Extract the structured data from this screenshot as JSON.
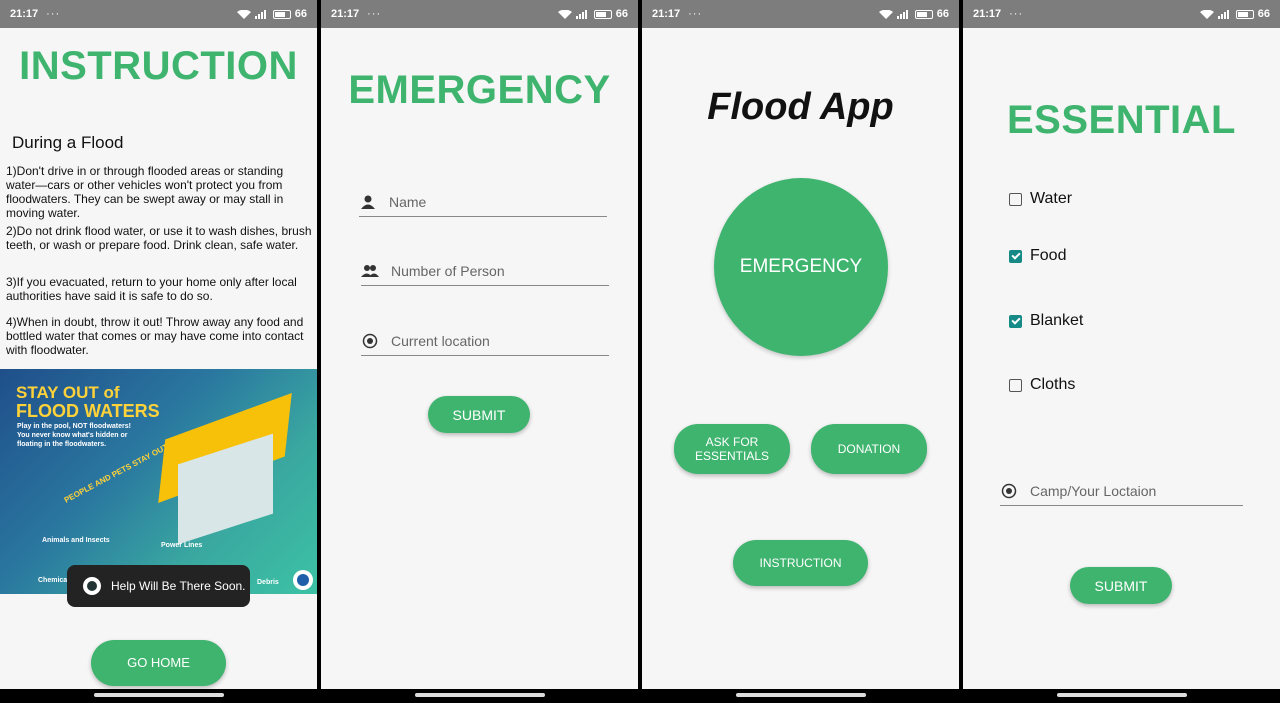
{
  "status_bar": {
    "time": "21:17",
    "dots": "···",
    "battery": "66"
  },
  "phone1": {
    "title": "INSTRUCTION",
    "subtitle": "During a Flood",
    "paragraphs": [
      "1)Don't drive in or through flooded areas or standing water—cars or other vehicles won't protect you from floodwaters. They can be swept away or may stall in moving water.",
      "2)Do not drink flood water, or use it to wash dishes, brush teeth, or wash or prepare food. Drink clean, safe water.",
      "3)If you evacuated, return to your home only after local authorities have said it is safe to do so.",
      "4)When in doubt, throw it out! Throw away any food and bottled water that comes or may have come into contact with floodwater."
    ],
    "poster": {
      "title_line1": "STAY OUT of",
      "title_line2": "FLOOD WATERS",
      "line1": "Play in the pool, NOT floodwaters!",
      "line2": "You never know what's hidden or",
      "line3": "floating in the floodwaters.",
      "diagonal": "PEOPLE AND PETS STAY OUT",
      "label_animals": "Animals and Insects",
      "label_power": "Power Lines",
      "label_chemical": "Chemical",
      "label_debris": "Debris"
    },
    "toast": "Help Will Be There Soon.",
    "go_home": "GO HOME"
  },
  "phone2": {
    "title": "EMERGENCY",
    "name_placeholder": "Name",
    "persons_placeholder": "Number of Person",
    "location_placeholder": "Current location",
    "submit": "SUBMIT"
  },
  "phone3": {
    "title": "Flood App",
    "emergency": "EMERGENCY",
    "ask_line1": "ASK FOR",
    "ask_line2": "ESSENTIALS",
    "donation": "DONATION",
    "instruction": "INSTRUCTION"
  },
  "phone4": {
    "title": "ESSENTIAL",
    "items": [
      {
        "label": "Water",
        "checked": false
      },
      {
        "label": "Food",
        "checked": true
      },
      {
        "label": "Blanket",
        "checked": true
      },
      {
        "label": "Cloths",
        "checked": false
      }
    ],
    "camp_placeholder": "Camp/Your Loctaion",
    "submit": "SUBMIT"
  },
  "colors": {
    "accent": "#3fb46f",
    "checkbox": "#168a86",
    "status_bar": "#7d7d7d"
  }
}
